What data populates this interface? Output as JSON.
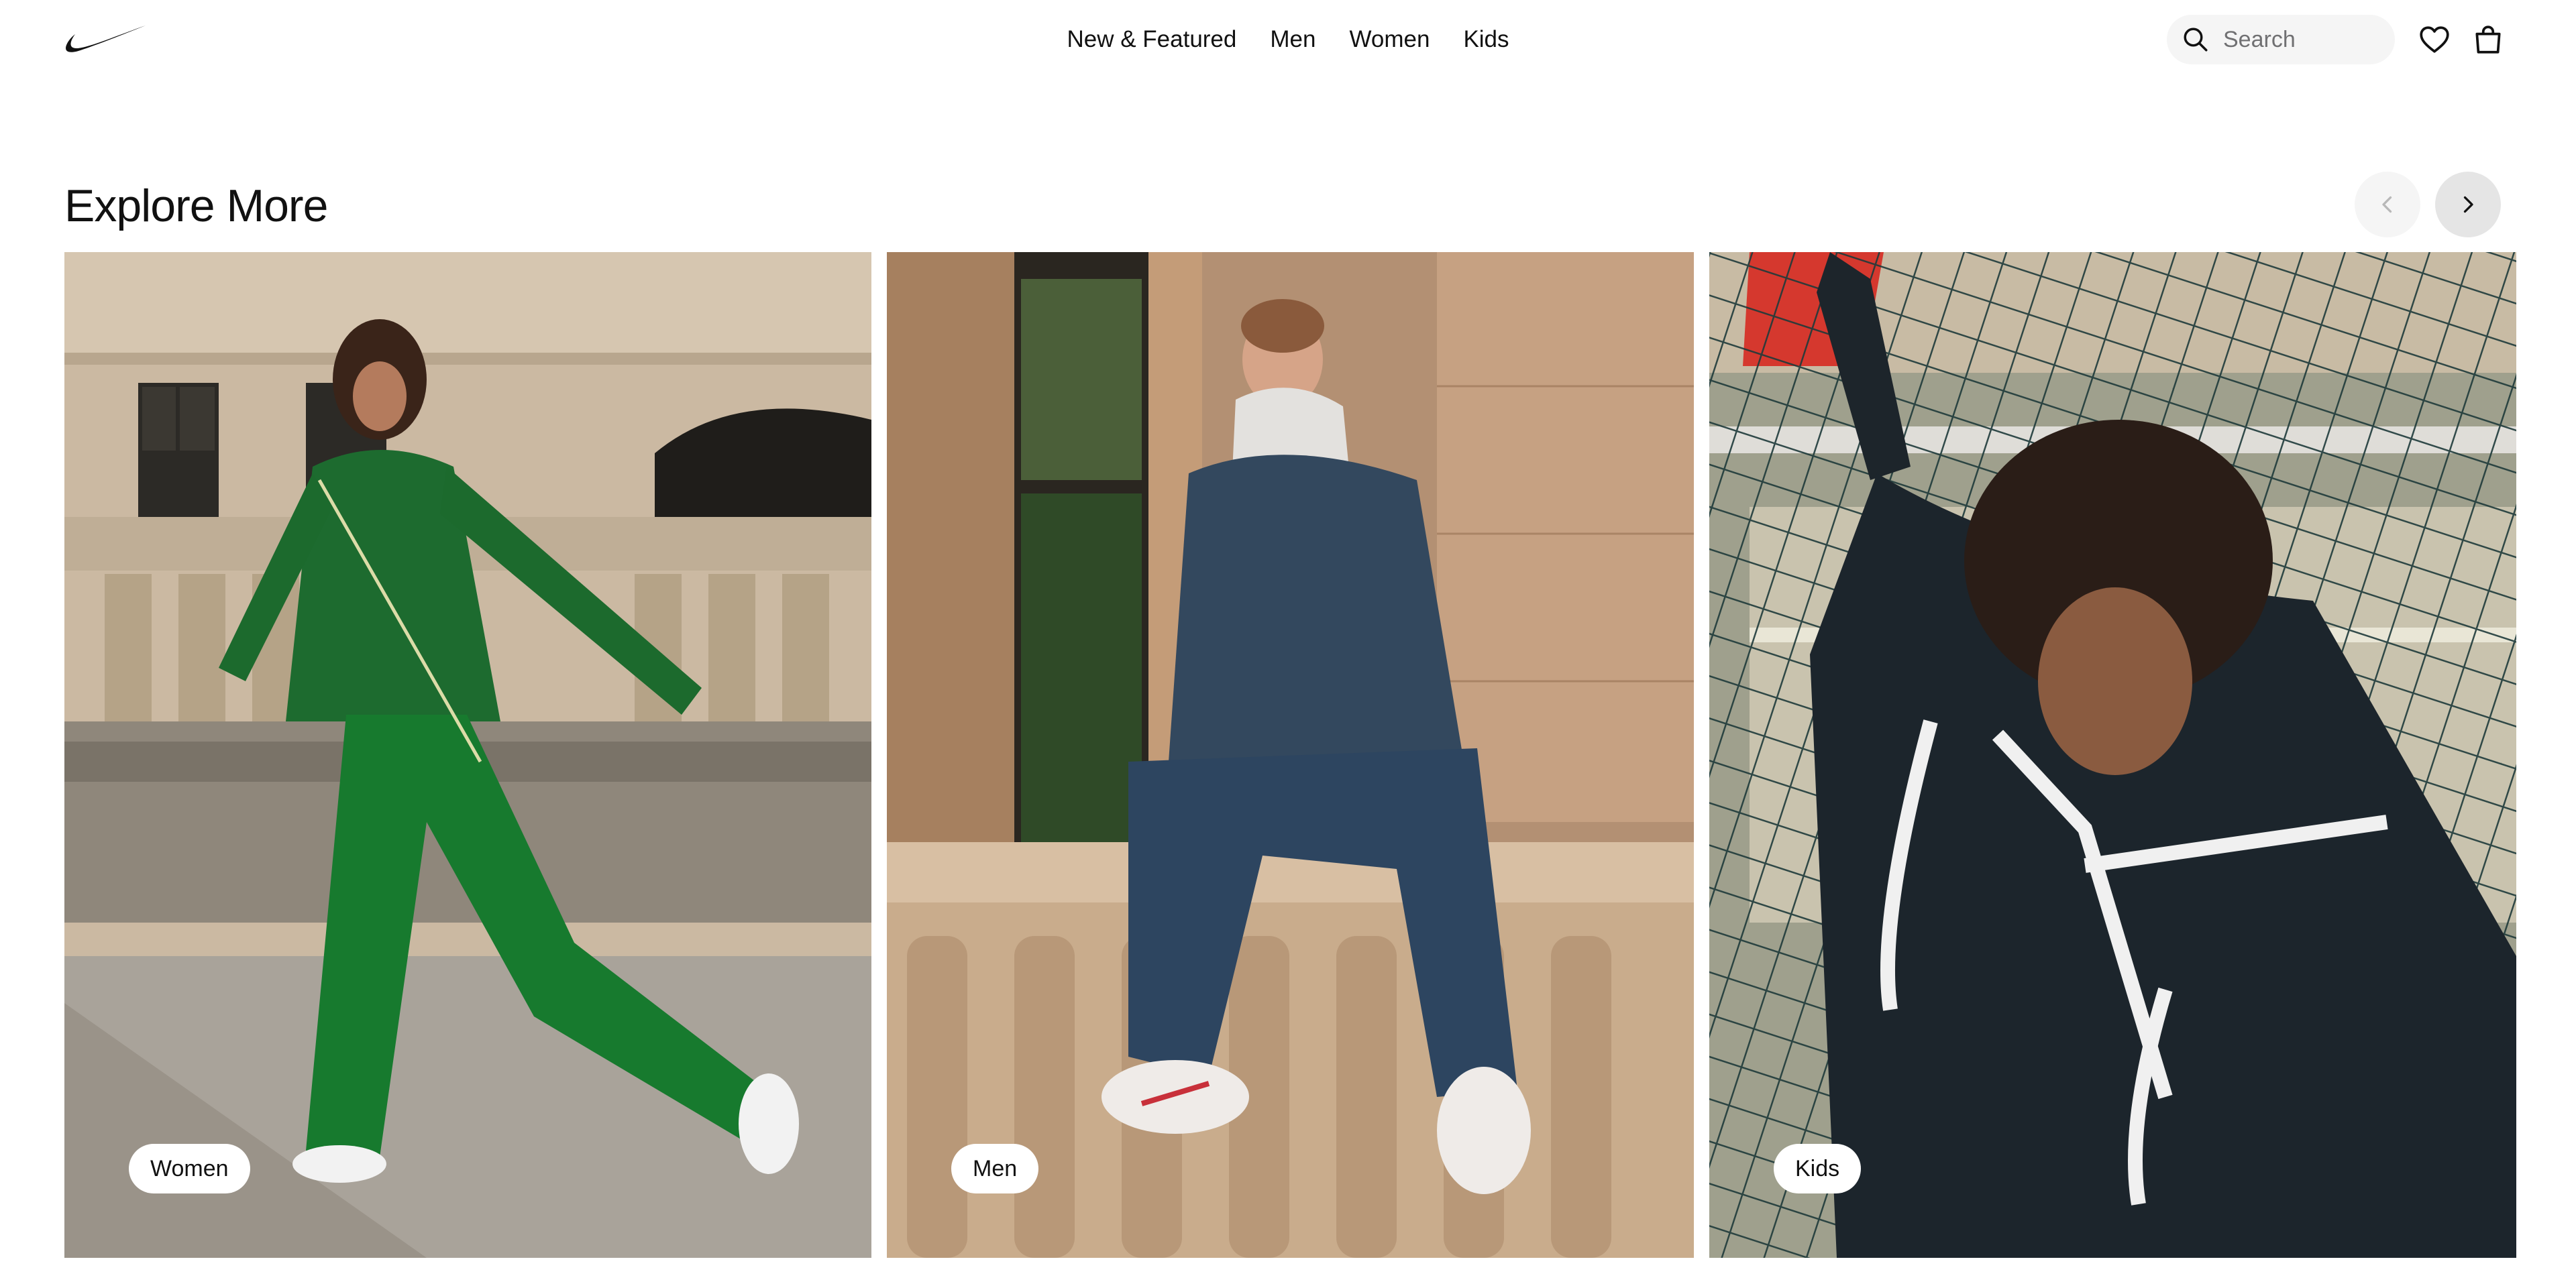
{
  "header": {
    "logo": "swoosh-logo",
    "nav": [
      "New & Featured",
      "Men",
      "Women",
      "Kids"
    ],
    "search_placeholder": "Search",
    "icons": [
      "search-icon",
      "heart-icon",
      "bag-icon"
    ]
  },
  "section": {
    "title": "Explore More",
    "prev_icon": "chevron-left-icon",
    "next_icon": "chevron-right-icon"
  },
  "cards": [
    {
      "label": "Women",
      "image": "woman-green-tracksuit-photo"
    },
    {
      "label": "Men",
      "image": "man-denim-outfit-photo"
    },
    {
      "label": "Kids",
      "image": "kid-black-zip-hoodie-photo"
    }
  ],
  "colors": {
    "text": "#111111",
    "pill_bg": "#ffffff",
    "search_bg": "#f5f5f5"
  }
}
